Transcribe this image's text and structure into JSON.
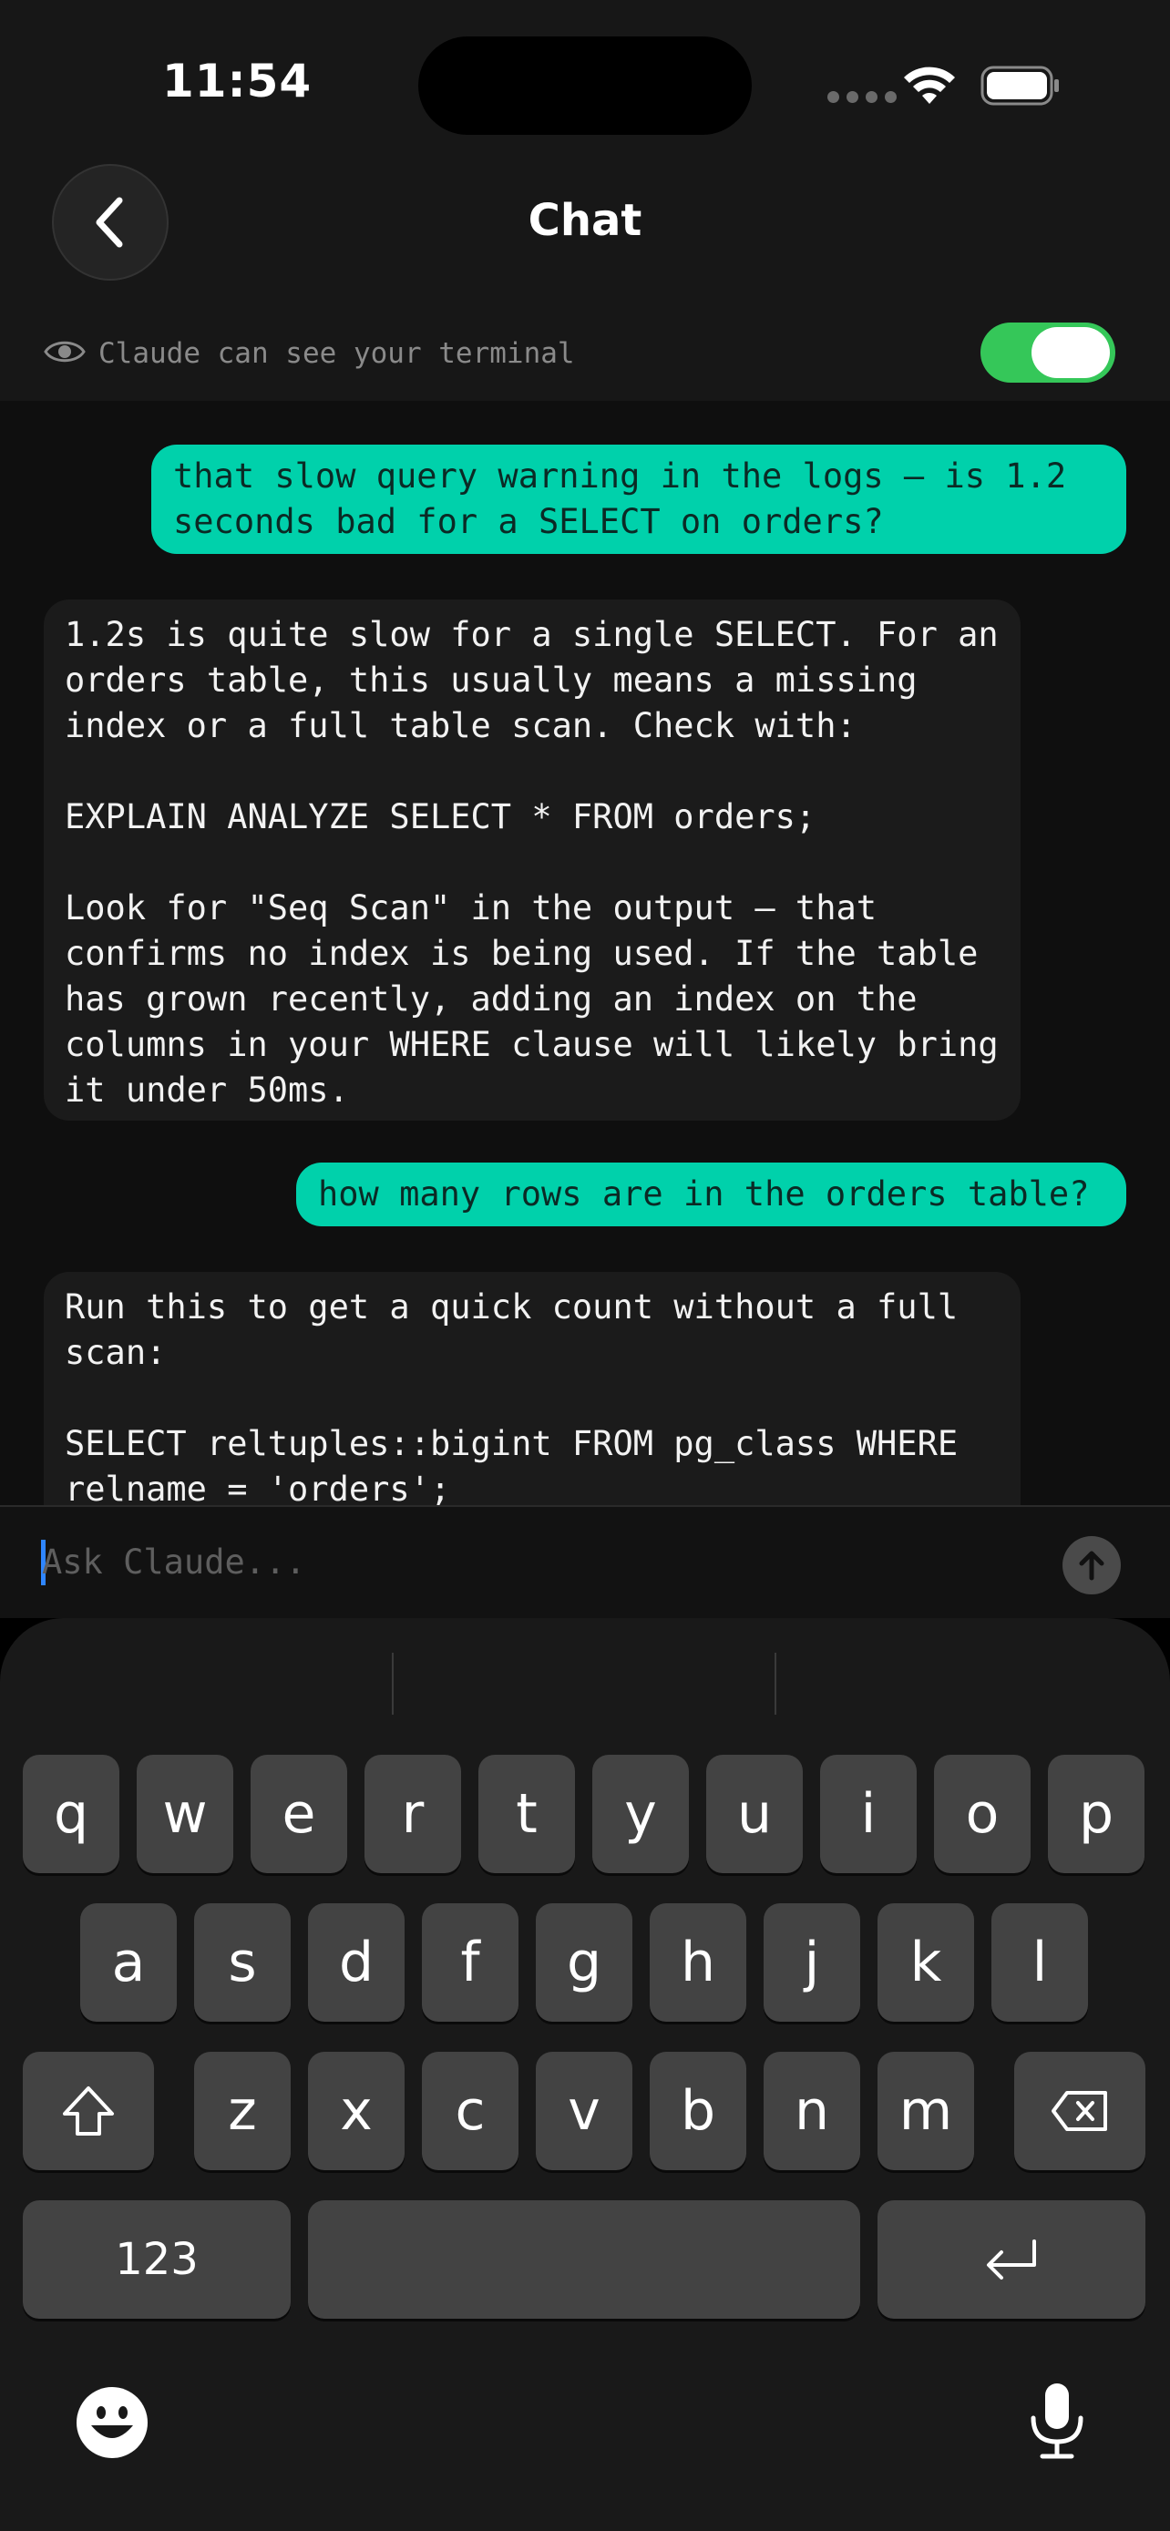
{
  "status_bar": {
    "time": "11:54"
  },
  "header": {
    "title": "Chat"
  },
  "visibility": {
    "label": "Claude can see your terminal",
    "enabled": true
  },
  "messages": [
    {
      "role": "user",
      "text": "that slow query warning in the logs — is 1.2 seconds bad for a SELECT on orders?"
    },
    {
      "role": "assistant",
      "text": "1.2s is quite slow for a single SELECT. For an orders table, this usually means a missing index or a full table scan. Check with:\n\nEXPLAIN ANALYZE SELECT * FROM orders;\n\nLook for \"Seq Scan\" in the output — that confirms no index is being used. If the table has grown recently, adding an index on the columns in your WHERE clause will likely bring it under 50ms."
    },
    {
      "role": "user",
      "text": "how many rows are in the orders table?"
    },
    {
      "role": "assistant",
      "text": "Run this to get a quick count without a full scan:\n\nSELECT reltuples::bigint FROM pg_class WHERE relname = 'orders';"
    }
  ],
  "composer": {
    "placeholder": "Ask Claude...",
    "value": ""
  },
  "keyboard": {
    "row1": [
      "q",
      "w",
      "e",
      "r",
      "t",
      "y",
      "u",
      "i",
      "o",
      "p"
    ],
    "row2": [
      "a",
      "s",
      "d",
      "f",
      "g",
      "h",
      "j",
      "k",
      "l"
    ],
    "row3": [
      "z",
      "x",
      "c",
      "v",
      "b",
      "n",
      "m"
    ],
    "numbers_key": "123"
  },
  "colors": {
    "accent": "#00d1ab",
    "toggle_on": "#35c759",
    "background": "#171717"
  }
}
